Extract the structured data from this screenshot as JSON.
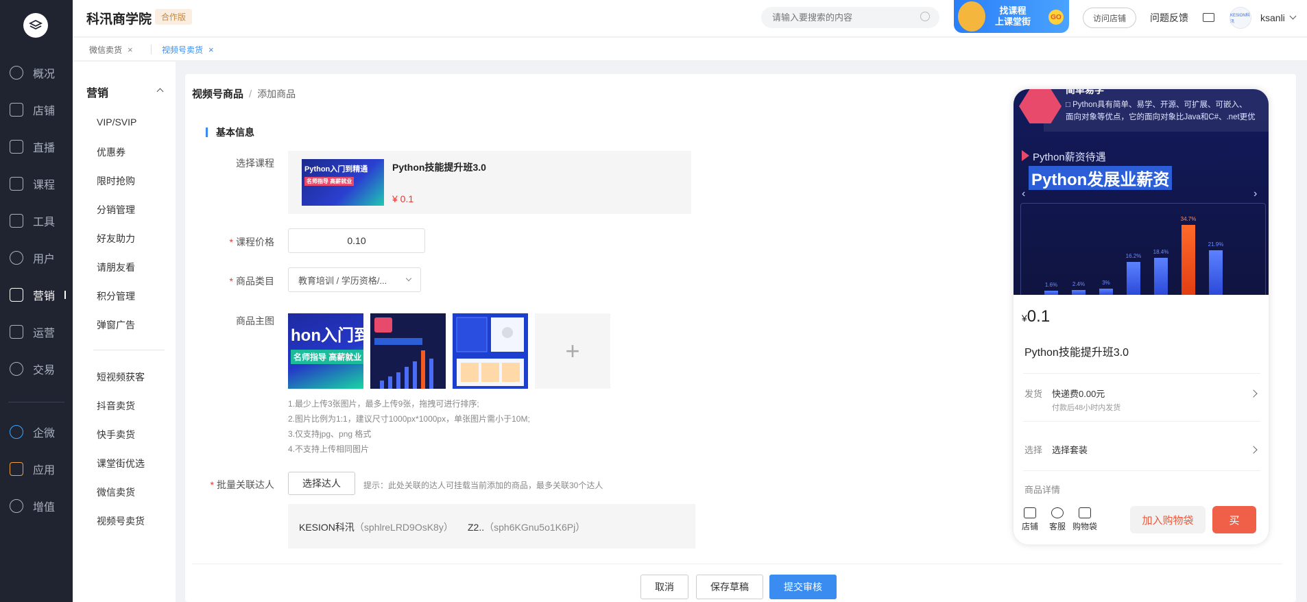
{
  "app": {
    "brand": "科汛商学院",
    "edition": "合作版"
  },
  "nav": {
    "items": [
      {
        "label": "概况",
        "icon": "clock-icon"
      },
      {
        "label": "店铺",
        "icon": "store-icon"
      },
      {
        "label": "直播",
        "icon": "video-icon"
      },
      {
        "label": "课程",
        "icon": "book-icon"
      },
      {
        "label": "工具",
        "icon": "toolbox-icon"
      },
      {
        "label": "用户",
        "icon": "user-icon"
      },
      {
        "label": "营销",
        "icon": "marketing-icon"
      },
      {
        "label": "运营",
        "icon": "monitor-icon"
      },
      {
        "label": "交易",
        "icon": "exchange-icon"
      },
      {
        "label": "企微",
        "icon": "wecom-icon"
      },
      {
        "label": "应用",
        "icon": "apps-icon"
      },
      {
        "label": "增值",
        "icon": "gauge-icon"
      }
    ]
  },
  "topbar": {
    "search_placeholder": "请输入要搜索的内容",
    "promo_line1": "找课程",
    "promo_line2": "上课堂街",
    "promo_go": "GO",
    "visit_store": "访问店铺",
    "feedback": "问题反馈",
    "avatar_text": "KESION科汛",
    "username": "ksanli"
  },
  "tabs": [
    {
      "label": "微信卖货",
      "close": "×"
    },
    {
      "label": "视频号卖货",
      "close": "×"
    }
  ],
  "submenu": {
    "title": "营销",
    "group1": [
      "VIP/SVIP",
      "优惠券",
      "限时抢购",
      "分销管理",
      "好友助力",
      "请朋友看",
      "积分管理",
      "弹窗广告"
    ],
    "group2": [
      "短视频获客",
      "抖音卖货",
      "快手卖货",
      "课堂街优选",
      "微信卖货",
      "视频号卖货"
    ]
  },
  "breadcrumb": {
    "parent": "视频号商品",
    "sep": "/",
    "current": "添加商品"
  },
  "form": {
    "section_title": "基本信息",
    "course_label": "选择课程",
    "course_thumb_text": "Python入门到精通",
    "course_thumb_sub": "名师指导 高薪就业",
    "course_name": "Python技能提升班3.0",
    "course_price": "¥ 0.1",
    "price_label": "课程价格",
    "price_value": "0.10",
    "category_label": "商品类目",
    "category_value": "教育培训 / 学历资格/...",
    "image_label": "商品主图",
    "img1_text": "hon入门到精",
    "img1_tag": "名师指导 高薪就业",
    "img_add": "+",
    "hints": [
      "1.最少上传3张图片，最多上传9张，拖拽可进行排序;",
      "2.图片比例为1:1，建议尺寸1000px*1000px，单张图片需小于10M;",
      "3.仅支持jpg、png 格式",
      "4.不支持上传相同图片"
    ],
    "talent_label": "批量关联达人",
    "pick_button": "选择达人",
    "pick_hint": "提示：此处关联的达人可挂载当前添加的商品，最多关联30个达人",
    "talents": [
      {
        "name": "KESION科汛",
        "id": "（sphlreLRD9OsK8y）"
      },
      {
        "name": "Z2..",
        "id": "（sph6KGnu5o1K6Pj）"
      }
    ]
  },
  "actions": {
    "cancel": "取消",
    "save_draft": "保存草稿",
    "submit": "提交审核"
  },
  "preview": {
    "banner_head": "简单易学",
    "banner_desc1": "□ Python具有简单、易学、开源、可扩展、可嵌入、",
    "banner_desc2": "面向对象等优点，它的面向对象比Java和C#、.net更优",
    "banner_sub": "Python薪资待遇",
    "banner_big": "Python发展业薪资",
    "arrow_left": "‹",
    "arrow_right": "›",
    "price_symbol": "¥",
    "price": "0.1",
    "title": "Python技能提升班3.0",
    "ship_label": "发货",
    "ship_value": "快递费0.00元",
    "ship_sub": "付款后48小时内发货",
    "choose_label": "选择",
    "choose_value": "选择套装",
    "detail_label": "商品详情",
    "tools": [
      {
        "label": "店铺",
        "icon": "home-icon"
      },
      {
        "label": "客服",
        "icon": "chat-icon"
      },
      {
        "label": "购物袋",
        "icon": "bag-icon"
      }
    ],
    "add_cart": "加入购物袋",
    "buy": "买"
  },
  "chart_data": {
    "type": "bar",
    "values": [
      1.6,
      2.4,
      3,
      16.2,
      18.4,
      34.7,
      21.9
    ],
    "labels": [
      "1.6%",
      "2.4%",
      "3%",
      "16.2%",
      "18.4%",
      "34.7%",
      "21.9%"
    ],
    "highlight_index": 5,
    "colors": {
      "bar": "#4a6cf7",
      "highlight": "#f4591f"
    }
  },
  "colors": {
    "primary": "#3b8cf0",
    "danger": "#e53935",
    "nav_bg": "#1f2430"
  }
}
